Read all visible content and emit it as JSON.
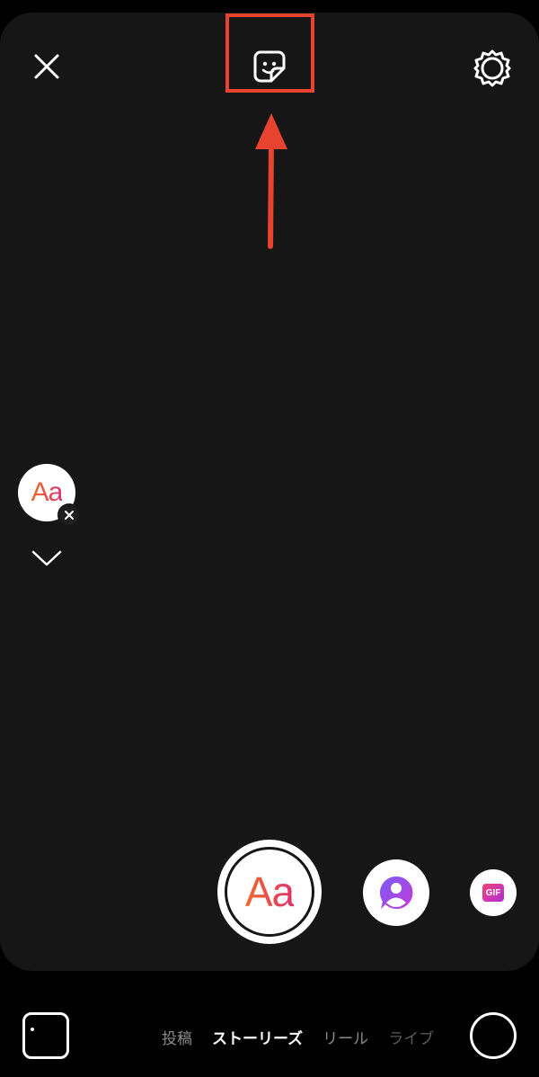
{
  "top_bar": {
    "close_icon": "close-icon",
    "sticker_icon": "sticker-icon",
    "settings_icon": "settings-gear-icon"
  },
  "annotation": {
    "highlight_color": "#e8432e"
  },
  "side_tools": {
    "text_tool_label": "Aa",
    "remove_icon": "close-small-icon",
    "collapse_icon": "chevron-down-icon"
  },
  "create_modes": {
    "main_label": "Aa",
    "mention_icon": "mention-person-icon",
    "gif_label": "GIF"
  },
  "bottom_nav": {
    "tabs": [
      {
        "label": "投稿",
        "active": false
      },
      {
        "label": "ストーリーズ",
        "active": true
      },
      {
        "label": "リール",
        "active": false
      },
      {
        "label": "ライブ",
        "active": false
      }
    ]
  },
  "colors": {
    "canvas_bg": "#161616",
    "accent_gradient_start": "#f06a2a",
    "accent_gradient_end": "#e1306c",
    "annotation_red": "#e8432e"
  }
}
